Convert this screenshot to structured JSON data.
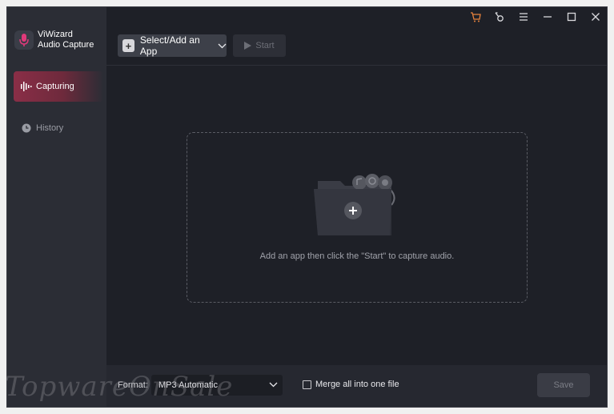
{
  "app": {
    "name_line1": "ViWizard",
    "name_line2": "Audio Capture"
  },
  "sidebar": {
    "items": [
      {
        "label": "Capturing",
        "icon": "waveform-icon",
        "active": true
      },
      {
        "label": "History",
        "icon": "clock-icon",
        "active": false
      }
    ]
  },
  "titlebar": {
    "icons": [
      "cart-icon",
      "key-icon",
      "menu-icon",
      "minimize-icon",
      "maximize-icon",
      "close-icon"
    ]
  },
  "toolbar": {
    "add_label": "Select/Add an App",
    "start_label": "Start"
  },
  "dropzone": {
    "text": "Add an app then click the \"Start\" to capture audio."
  },
  "bottom": {
    "format_label": "Format:",
    "format_value": "MP3 Automatic",
    "merge_label": "Merge all into one file",
    "merge_checked": false,
    "save_label": "Save"
  },
  "watermark": "TopwareOnSale",
  "colors": {
    "accent": "#8a2e47",
    "background": "#1e2027",
    "sidebar": "#2b2d35",
    "cart": "#e8823c"
  }
}
